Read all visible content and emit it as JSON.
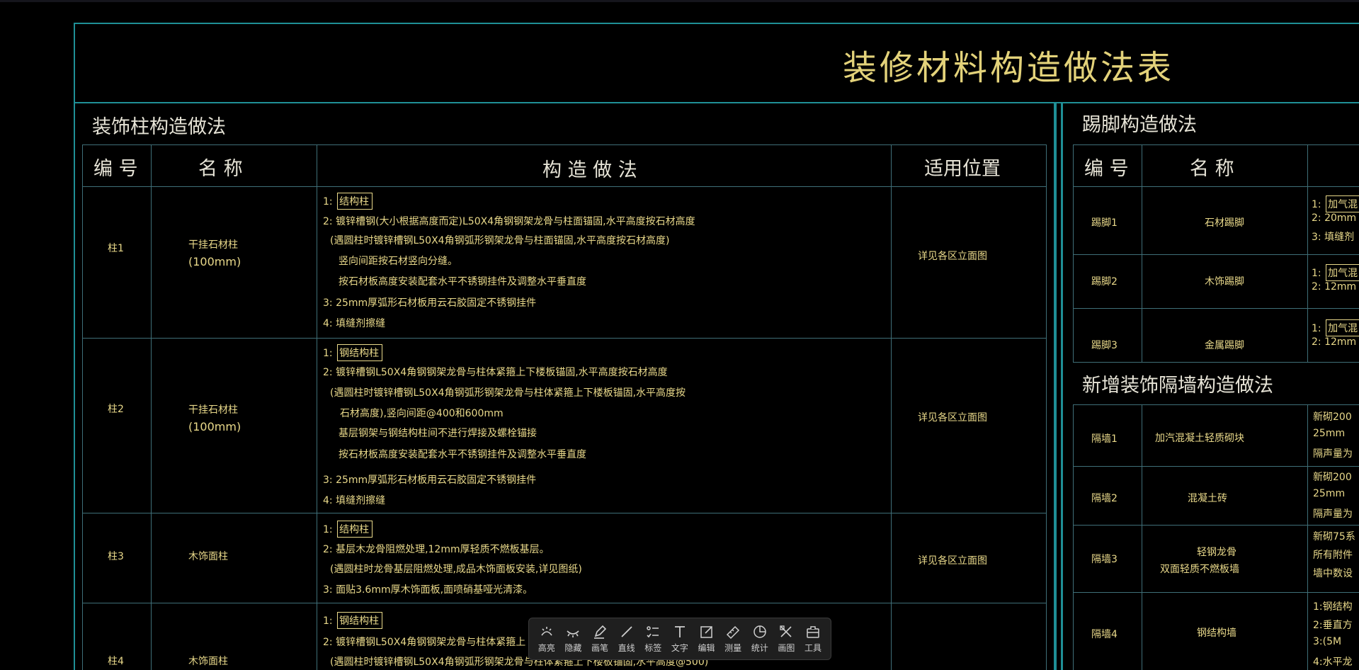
{
  "drawing": {
    "title": "装修材料构造做法表",
    "colors": {
      "line": "#3f6f78",
      "frame": "#1f8f96",
      "text": "#e9d98a",
      "header_text": "#e6e3d6",
      "background": "#000000"
    }
  },
  "left_table": {
    "section_title": "装饰柱构造做法",
    "headers": {
      "code": "编 号",
      "name": "名 称",
      "method": "构 造 做 法",
      "position": "适用位置"
    },
    "rows": [
      {
        "code": "柱1",
        "name_line1": "干挂石材柱",
        "name_line2": "(100mm)",
        "position": "详见各区立面图",
        "lines": [
          {
            "prefix": "1:",
            "text": "结构柱",
            "boxed": true
          },
          {
            "prefix": "2:",
            "text": "镀锌槽钢(大小根据高度而定)L50X4角钢钢架龙骨与柱面锚固,水平高度按石材高度"
          },
          {
            "prefix": "",
            "text": "(遇圆柱时镀锌槽钢L50X4角钢弧形钢架龙骨与柱面锚固,水平高度按石材高度)"
          },
          {
            "prefix": "",
            "text": "竖向间距按石材竖向分缝。"
          },
          {
            "prefix": "",
            "text": "按石材板高度安装配套水平不锈钢挂件及调整水平垂直度"
          },
          {
            "prefix": "3:",
            "text": "25mm厚弧形石材板用云石胶固定不锈钢挂件"
          },
          {
            "prefix": "4:",
            "text": "填缝剂擦缝"
          }
        ]
      },
      {
        "code": "柱2",
        "name_line1": "干挂石材柱",
        "name_line2": "(100mm)",
        "position": "详见各区立面图",
        "lines": [
          {
            "prefix": "1:",
            "text": "钢结构柱",
            "boxed": true
          },
          {
            "prefix": "2:",
            "text": "镀锌槽钢L50X4角钢钢架龙骨与柱体紧箍上下楼板锚固,水平高度按石材高度"
          },
          {
            "prefix": "",
            "text": "(遇圆柱时镀锌槽钢L50X4角钢弧形钢架龙骨与柱体紧箍上下楼板锚固,水平高度按"
          },
          {
            "prefix": "",
            "text": "石材高度),竖向间距@400和600mm"
          },
          {
            "prefix": "",
            "text": "基层钢架与钢结构柱间不进行焊接及螺栓锚接"
          },
          {
            "prefix": "",
            "text": "按石材板高度安装配套水平不锈钢挂件及调整水平垂直度"
          },
          {
            "prefix": "3:",
            "text": "25mm厚弧形石材板用云石胶固定不锈钢挂件"
          },
          {
            "prefix": "4:",
            "text": "填缝剂擦缝"
          }
        ]
      },
      {
        "code": "柱3",
        "name_line1": "木饰面柱",
        "name_line2": "",
        "position": "详见各区立面图",
        "lines": [
          {
            "prefix": "1:",
            "text": "结构柱",
            "boxed": true
          },
          {
            "prefix": "2:",
            "text": "基层木龙骨阻燃处理,12mm厚轻质不燃板基层。"
          },
          {
            "prefix": "",
            "text": "(遇圆柱时龙骨基层阻燃处理,成品木饰面板安装,详见图纸)"
          },
          {
            "prefix": "3:",
            "text": "面贴3.6mm厚木饰面板,面喷硝基哑光清漆。"
          }
        ]
      },
      {
        "code": "柱4",
        "name_line1": "木饰面柱",
        "name_line2": "",
        "position": "",
        "lines": [
          {
            "prefix": "1:",
            "text": "钢结构柱",
            "boxed": true
          },
          {
            "prefix": "2:",
            "text": "镀锌槽钢L50X4角钢钢架龙骨与柱体紧箍上"
          },
          {
            "prefix": "",
            "text": "(遇圆柱时镀锌槽钢L50X4角钢弧形钢架龙骨与柱体紧箍上下楼板锚固,水平高度@500)"
          }
        ]
      }
    ]
  },
  "right_top_table": {
    "section_title": "踢脚构造做法",
    "headers": {
      "code": "编 号",
      "name": "名 称"
    },
    "rows": [
      {
        "code": "踢脚1",
        "name": "石材踢脚",
        "lines": [
          {
            "prefix": "1:",
            "text": "加气混",
            "boxed": true
          },
          {
            "prefix": "2:",
            "text": "20mm"
          },
          {
            "prefix": "3:",
            "text": "填缝剂"
          }
        ]
      },
      {
        "code": "踢脚2",
        "name": "木饰踢脚",
        "lines": [
          {
            "prefix": "1:",
            "text": "加气混",
            "boxed": true
          },
          {
            "prefix": "2:",
            "text": "12mm"
          }
        ]
      },
      {
        "code": "踢脚3",
        "name": "金属踢脚",
        "lines": [
          {
            "prefix": "1:",
            "text": "加气混",
            "boxed": true
          },
          {
            "prefix": "2:",
            "text": "12mm"
          }
        ]
      }
    ]
  },
  "right_bottom_table": {
    "section_title": "新增装饰隔墙构造做法",
    "rows": [
      {
        "code": "隔墙1",
        "name_line1": "加汽混凝土轻质砌块",
        "name_line2": "",
        "lines": [
          "新砌200",
          "25mm",
          "隔声量为"
        ]
      },
      {
        "code": "隔墙2",
        "name_line1": "混凝土砖",
        "name_line2": "",
        "lines": [
          "新砌200",
          "25mm",
          "隔声量为"
        ]
      },
      {
        "code": "隔墙3",
        "name_line1": "轻钢龙骨",
        "name_line2": "双面轻质不燃板墙",
        "lines": [
          "新砌75系",
          "所有附件",
          "墙中数设"
        ]
      },
      {
        "code": "隔墙4",
        "name_line1": "钢结构墙",
        "name_line2": "",
        "lines": [
          "1:钢结构",
          "2:垂直方",
          "3:(5M",
          "4:水平龙"
        ]
      }
    ]
  },
  "toolbar": {
    "items": [
      {
        "label": "高亮",
        "icon": "highlight-icon"
      },
      {
        "label": "隐藏",
        "icon": "hide-icon"
      },
      {
        "label": "画笔",
        "icon": "pen-icon"
      },
      {
        "label": "直线",
        "icon": "line-icon"
      },
      {
        "label": "标签",
        "icon": "tag-icon"
      },
      {
        "label": "文字",
        "icon": "text-icon"
      },
      {
        "label": "编辑",
        "icon": "edit-icon"
      },
      {
        "label": "测量",
        "icon": "measure-icon"
      },
      {
        "label": "统计",
        "icon": "stats-icon"
      },
      {
        "label": "画图",
        "icon": "draw-icon"
      },
      {
        "label": "工具",
        "icon": "tools-icon"
      }
    ]
  }
}
